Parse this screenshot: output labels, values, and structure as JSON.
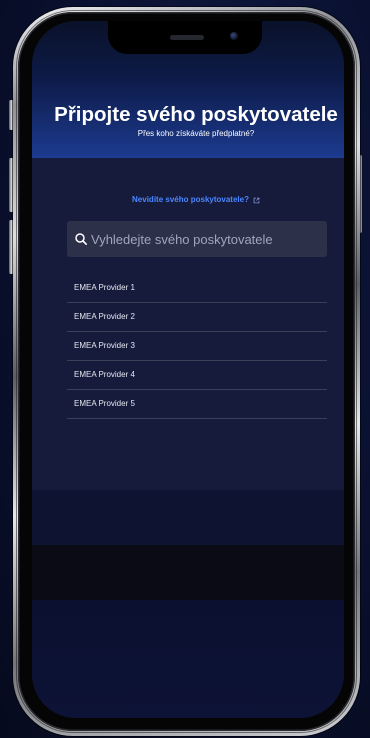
{
  "header": {
    "title": "Připojte svého poskytovatele",
    "subtitle": "Přes koho získáváte předplatné?"
  },
  "help_link": {
    "label": "Nevidíte svého poskytovatele?",
    "icon": "external-link-icon"
  },
  "search": {
    "placeholder": "Vyhledejte svého poskytovatele",
    "icon": "search-icon"
  },
  "providers": [
    {
      "label": "EMEA Provider 1"
    },
    {
      "label": "EMEA Provider 2"
    },
    {
      "label": "EMEA Provider 3"
    },
    {
      "label": "EMEA Provider 4"
    },
    {
      "label": "EMEA Provider 5"
    }
  ],
  "colors": {
    "screen_background": "#0e1332",
    "header_glow": "#1c3a8f",
    "panel": "#161b3c",
    "accent_link": "#4a86ff",
    "search_field": "#2c3049",
    "text": "#ffffff",
    "placeholder": "#a0a6bd",
    "divider": "#3b3f58"
  }
}
